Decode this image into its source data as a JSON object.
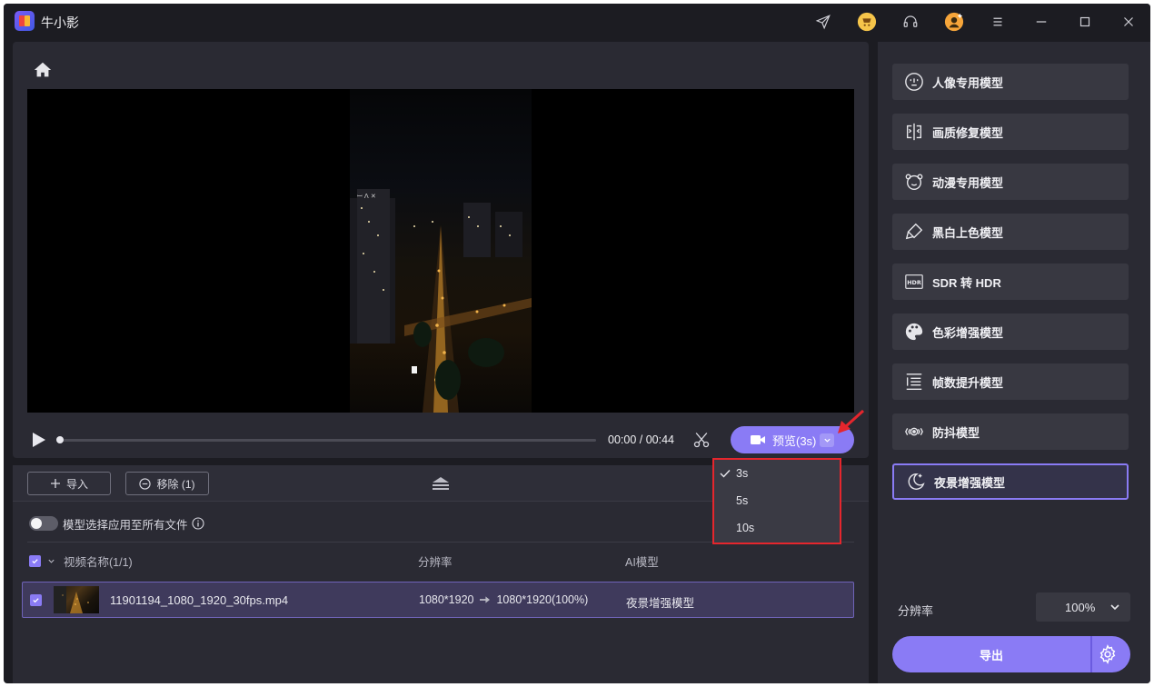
{
  "app": {
    "title": "牛小影"
  },
  "player": {
    "time": "00:00 / 00:44",
    "progress_percent": 0,
    "preview_label": "预览(3s)"
  },
  "preview_menu": {
    "items": [
      {
        "label": "3s",
        "checked": true
      },
      {
        "label": "5s",
        "checked": false
      },
      {
        "label": "10s",
        "checked": false
      }
    ]
  },
  "toolbar": {
    "import_label": "导入",
    "remove_label": "移除 (1)"
  },
  "apply_all": {
    "label": "模型选择应用至所有文件",
    "enabled": false
  },
  "table": {
    "columns": {
      "name": "视频名称(1/1)",
      "resolution": "分辨率",
      "model": "AI模型"
    },
    "rows": [
      {
        "file_name": "11901194_1080_1920_30fps.mp4",
        "res_from": "1080*1920",
        "res_to": "1080*1920(100%)",
        "model": "夜景增强模型",
        "checked": true
      }
    ]
  },
  "models": [
    {
      "label": "人像专用模型",
      "icon": "portrait-face-icon",
      "active": false
    },
    {
      "label": "画质修复模型",
      "icon": "split-image-icon",
      "active": false
    },
    {
      "label": "动漫专用模型",
      "icon": "anime-bear-icon",
      "active": false
    },
    {
      "label": "黑白上色模型",
      "icon": "paint-brush-icon",
      "active": false
    },
    {
      "label": "SDR 转 HDR",
      "icon": "hdr-icon",
      "active": false
    },
    {
      "label": "色彩增强模型",
      "icon": "palette-icon",
      "active": false
    },
    {
      "label": "帧数提升模型",
      "icon": "frames-icon",
      "active": false
    },
    {
      "label": "防抖模型",
      "icon": "stabilize-icon",
      "active": false
    },
    {
      "label": "夜景增强模型",
      "icon": "night-moon-icon",
      "active": true
    }
  ],
  "output": {
    "resolution_label": "分辨率",
    "resolution_value": "100%",
    "export_label": "导出"
  },
  "colors": {
    "accent": "#8a7bf5",
    "window_bg": "#1c1c22",
    "panel_bg": "#2a2a33",
    "highlight_red": "#e5262d"
  }
}
